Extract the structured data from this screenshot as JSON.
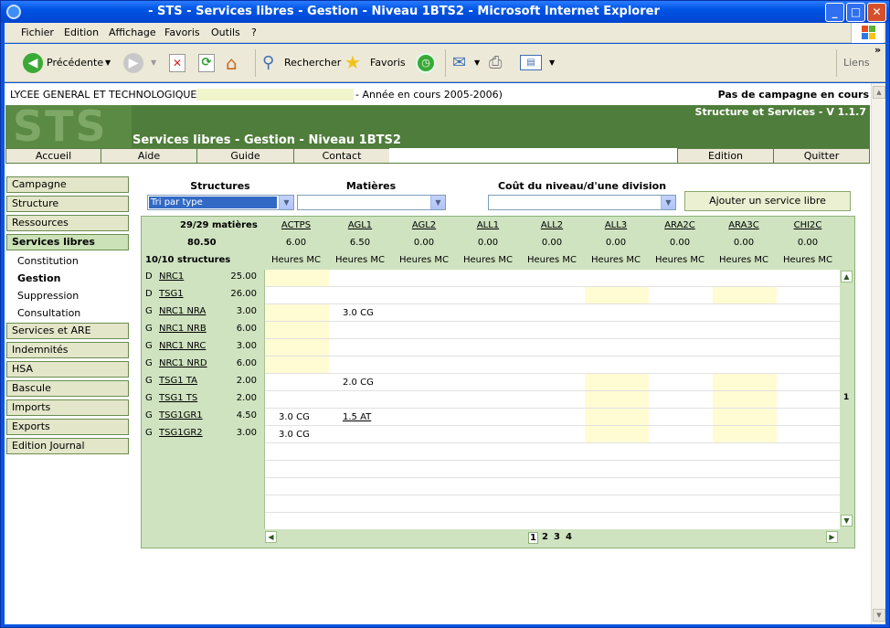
{
  "window": {
    "title": "- STS - Services libres - Gestion - Niveau 1BTS2 - Microsoft Internet Explorer"
  },
  "menu": [
    "Fichier",
    "Edition",
    "Affichage",
    "Favoris",
    "Outils",
    "?"
  ],
  "toolbar": {
    "back": "Précédente",
    "search": "Rechercher",
    "favorites": "Favoris",
    "links": "Liens"
  },
  "info": {
    "school": "LYCEE GENERAL ET TECHNOLOGIQUE",
    "year": "- Année en cours 2005-2006)",
    "campaign": "Pas de campagne en cours"
  },
  "banner": {
    "logo": "STS",
    "version": "Structure et Services - V 1.1.7",
    "title": "Services libres - Gestion - Niveau 1BTS2"
  },
  "nav": {
    "left": [
      "Accueil",
      "Aide",
      "Guide",
      "Contact"
    ],
    "right": [
      "Edition",
      "Quitter"
    ]
  },
  "sidebar": {
    "top": [
      "Campagne",
      "Structure",
      "Ressources"
    ],
    "active": "Services libres",
    "sub": [
      "Constitution",
      "Gestion",
      "Suppression",
      "Consultation"
    ],
    "bottom": [
      "Services et ARE",
      "Indemnités",
      "HSA",
      "Bascule",
      "Imports",
      "Exports",
      "Edition Journal"
    ]
  },
  "filters": {
    "structures_label": "Structures",
    "structures_value": "Tri par type",
    "matieres_label": "Matières",
    "cout_label": "Coût du niveau/d'une division",
    "add_button": "Ajouter un service libre"
  },
  "grid": {
    "matieres_count": "29/29 matières",
    "total": "80.50",
    "structures_count": "10/10 structures",
    "columns": [
      {
        "code": "ACTPS",
        "value": "6.00",
        "sub": "Heures MC"
      },
      {
        "code": "AGL1",
        "value": "6.50",
        "sub": "Heures MC"
      },
      {
        "code": "AGL2",
        "value": "0.00",
        "sub": "Heures MC"
      },
      {
        "code": "ALL1",
        "value": "0.00",
        "sub": "Heures MC"
      },
      {
        "code": "ALL2",
        "value": "0.00",
        "sub": "Heures MC"
      },
      {
        "code": "ALL3",
        "value": "0.00",
        "sub": "Heures MC"
      },
      {
        "code": "ARA2C",
        "value": "0.00",
        "sub": "Heures MC"
      },
      {
        "code": "ARA3C",
        "value": "0.00",
        "sub": "Heures MC"
      },
      {
        "code": "CHI2C",
        "value": "0.00",
        "sub": "Heures MC"
      }
    ],
    "rows": [
      {
        "type": "D",
        "name": "NRC1",
        "hours": "25.00"
      },
      {
        "type": "D",
        "name": "TSG1",
        "hours": "26.00"
      },
      {
        "type": "G",
        "name": "NRC1 NRA",
        "hours": "3.00"
      },
      {
        "type": "G",
        "name": "NRC1 NRB",
        "hours": "6.00"
      },
      {
        "type": "G",
        "name": "NRC1 NRC",
        "hours": "3.00"
      },
      {
        "type": "G",
        "name": "NRC1 NRD",
        "hours": "6.00"
      },
      {
        "type": "G",
        "name": "TSG1 TA",
        "hours": "2.00"
      },
      {
        "type": "G",
        "name": "TSG1 TS",
        "hours": "2.00"
      },
      {
        "type": "G",
        "name": "TSG1GR1",
        "hours": "4.50"
      },
      {
        "type": "G",
        "name": "TSG1GR2",
        "hours": "3.00"
      }
    ],
    "cells": {
      "r2c1": "3.0 CG",
      "r6c1": "2.0 CG",
      "r8c0": "3.0 CG",
      "r8c1": "1.5 AT",
      "r9c0": "3.0 CG"
    },
    "column_page": "1",
    "pages": [
      "1",
      "2",
      "3",
      "4"
    ]
  }
}
